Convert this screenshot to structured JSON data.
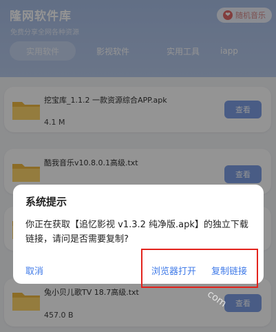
{
  "header": {
    "title": "隆网软件库",
    "subtitle": "免费分享全网各种资源",
    "music_button": "随机音乐",
    "tabs": [
      "实用软件",
      "影视软件",
      "实用工具",
      "iapp"
    ]
  },
  "items": [
    {
      "name": "挖宝库_1.1.2 一款资源综合APP.apk",
      "size": "4.1 M",
      "button": "查看"
    },
    {
      "name": "酷我音乐v10.8.0.1高级.txt",
      "size": "",
      "button": "查看"
    },
    {
      "name": "",
      "size": "",
      "button": ""
    },
    {
      "name": "兔小贝儿歌TV 18.7高级.txt",
      "size": "457.0 B",
      "button": "查看"
    }
  ],
  "dialog": {
    "title": "系统提示",
    "message": "你正在获取【追忆影视 v1.3.2 纯净版.apk】的独立下载链接，请问是否需要复制?",
    "cancel": "取消",
    "open_browser": "浏览器打开",
    "copy_link": "复制链接"
  },
  "watermark": "com"
}
